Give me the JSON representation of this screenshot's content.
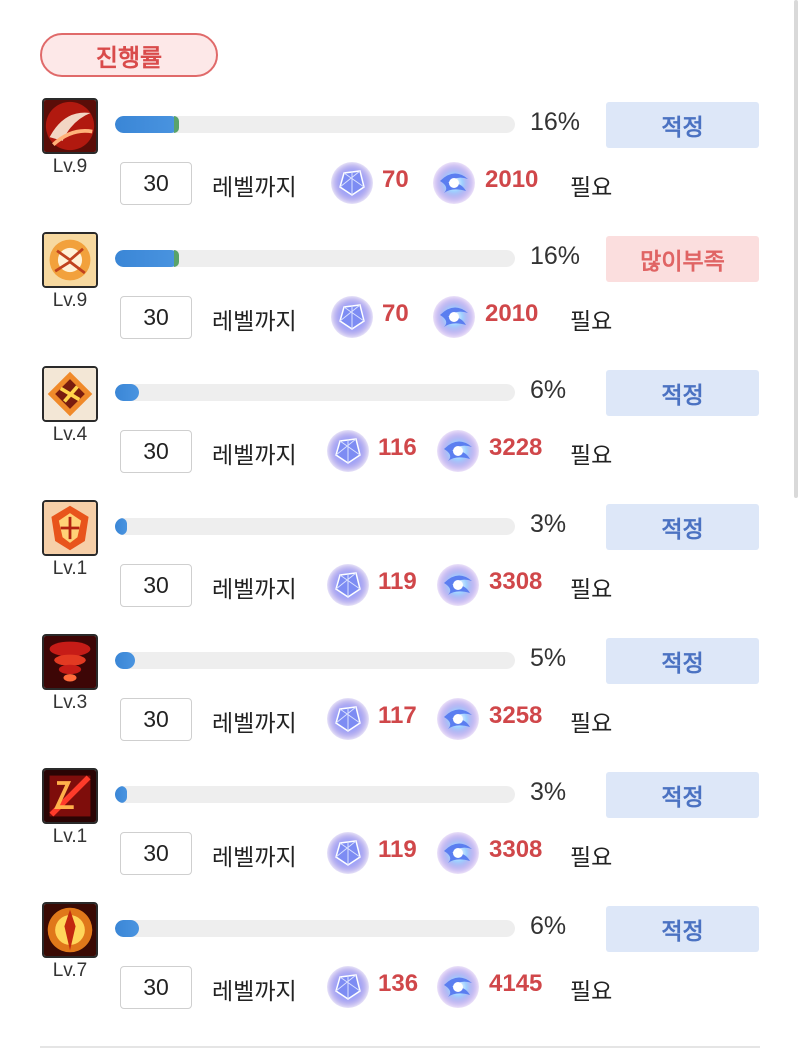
{
  "header": {
    "title": "진행률"
  },
  "labels": {
    "until": "레벨까지",
    "need": "필요"
  },
  "colors": {
    "accent_blue": "#3a86d6",
    "ok_bg": "#dde7f8",
    "ok_text": "#4b72c2",
    "low_bg": "#fbdede",
    "low_text": "#e06464",
    "cost_text": "#d0474a"
  },
  "rows": [
    {
      "level": "Lv.9",
      "percent_text": "16%",
      "progress": 0.16,
      "status": "적정",
      "status_kind": "ok",
      "target": "30",
      "cost_a": "70",
      "cost_b": "2010",
      "icon": "red-slash-skill-icon"
    },
    {
      "level": "Lv.9",
      "percent_text": "16%",
      "progress": 0.16,
      "status": "많이부족",
      "status_kind": "low",
      "target": "30",
      "cost_a": "70",
      "cost_b": "2010",
      "icon": "orange-burst-skill-icon"
    },
    {
      "level": "Lv.4",
      "percent_text": "6%",
      "progress": 0.06,
      "status": "적정",
      "status_kind": "ok",
      "target": "30",
      "cost_a": "116",
      "cost_b": "3228",
      "icon": "diamond-rune-skill-icon"
    },
    {
      "level": "Lv.1",
      "percent_text": "3%",
      "progress": 0.03,
      "status": "적정",
      "status_kind": "ok",
      "target": "30",
      "cost_a": "119",
      "cost_b": "3308",
      "icon": "flame-crest-skill-icon"
    },
    {
      "level": "Lv.3",
      "percent_text": "5%",
      "progress": 0.05,
      "status": "적정",
      "status_kind": "ok",
      "target": "30",
      "cost_a": "117",
      "cost_b": "3258",
      "icon": "red-tornado-skill-icon"
    },
    {
      "level": "Lv.1",
      "percent_text": "3%",
      "progress": 0.03,
      "status": "적정",
      "status_kind": "ok",
      "target": "30",
      "cost_a": "119",
      "cost_b": "3308",
      "icon": "crimson-strike-skill-icon"
    },
    {
      "level": "Lv.7",
      "percent_text": "6%",
      "progress": 0.06,
      "status": "적정",
      "status_kind": "ok",
      "target": "30",
      "cost_a": "136",
      "cost_b": "4145",
      "icon": "golden-aura-skill-icon"
    }
  ]
}
